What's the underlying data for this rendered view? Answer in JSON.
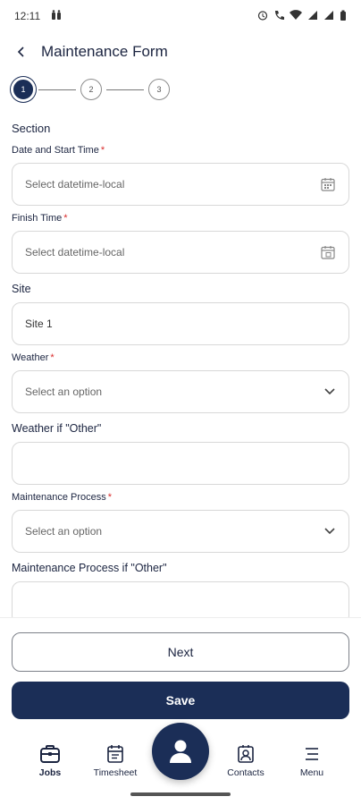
{
  "status_bar": {
    "time": "12:11"
  },
  "header": {
    "title": "Maintenance Form"
  },
  "stepper": {
    "steps": [
      "1",
      "2",
      "3"
    ],
    "active_step": 1
  },
  "form": {
    "section_title": "Section",
    "fields": [
      {
        "label": "Date and Start Time",
        "required": "*",
        "placeholder": "Select datetime-local",
        "icon": "calendar-icon"
      },
      {
        "label": "Finish Time",
        "required": "*",
        "placeholder": "Select datetime-local",
        "icon": "calendar-icon"
      },
      {
        "label": "Site",
        "value": "Site 1"
      },
      {
        "label": "Weather",
        "required": "*",
        "placeholder": "Select an option",
        "icon": "chevron-down-icon"
      },
      {
        "label": "Weather if \"Other\"",
        "value": ""
      },
      {
        "label": "Maintenance Process",
        "required": "*",
        "placeholder": "Select an option",
        "icon": "chevron-down-icon"
      },
      {
        "label": "Maintenance Process if \"Other\"",
        "value": ""
      }
    ]
  },
  "actions": {
    "next_label": "Next",
    "save_label": "Save"
  },
  "bottom_nav": {
    "items": [
      {
        "label": "Jobs",
        "icon": "briefcase-icon"
      },
      {
        "label": "Timesheet",
        "icon": "timesheet-icon"
      },
      {
        "label": "Contacts",
        "icon": "contacts-icon"
      },
      {
        "label": "Menu",
        "icon": "menu-icon"
      }
    ],
    "center_icon": "profile-icon"
  },
  "colors": {
    "primary": "#1b2e57",
    "required": "#d92b2b",
    "border": "#d8d8d8"
  }
}
